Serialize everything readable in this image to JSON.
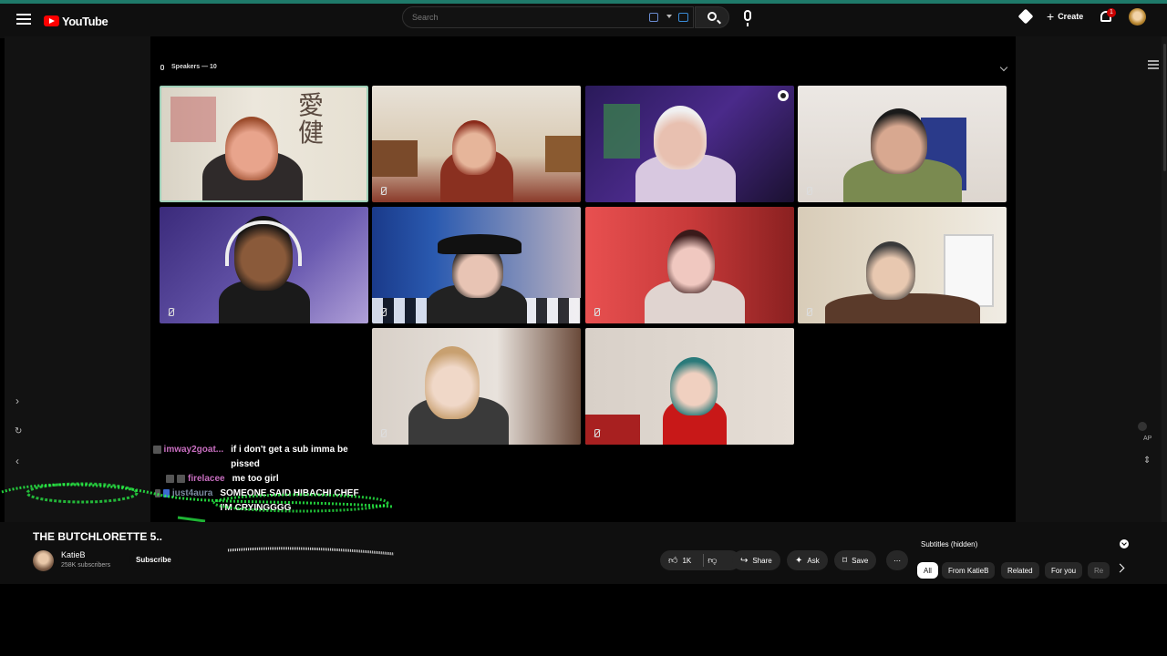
{
  "header": {
    "logo_text": "YouTube",
    "search_placeholder": "Search",
    "create_label": "Create",
    "notification_count": "1"
  },
  "stage": {
    "speakers_label": "Speakers — 10"
  },
  "chat": [
    {
      "user": "imway2goat...",
      "message": "if i don't get a sub imma be pissed"
    },
    {
      "user": "firelacee",
      "message": "me too girl"
    },
    {
      "user": "just4aura",
      "message": "SOMEONE SAID HIBACHI CHEF I'M CRYINGGGG"
    }
  ],
  "video": {
    "title": "THE BUTCHLORETTE 5..",
    "channel_name": "KatieB",
    "subscribers": "258K subscribers",
    "subscribe_label": "Subscribe",
    "like_count": "1K",
    "share_label": "Share",
    "ask_label": "Ask",
    "save_label": "Save"
  },
  "side_panel": {
    "subtitles_label": "Subtitles (hidden)",
    "autoplay_label": "AP",
    "chips": [
      "All",
      "From KatieB",
      "Related",
      "For you",
      "Re"
    ]
  },
  "colors": {
    "brand_red": "#ff0000",
    "chat_username": "#c86ec0",
    "glitch_green": "#2bff4a"
  }
}
